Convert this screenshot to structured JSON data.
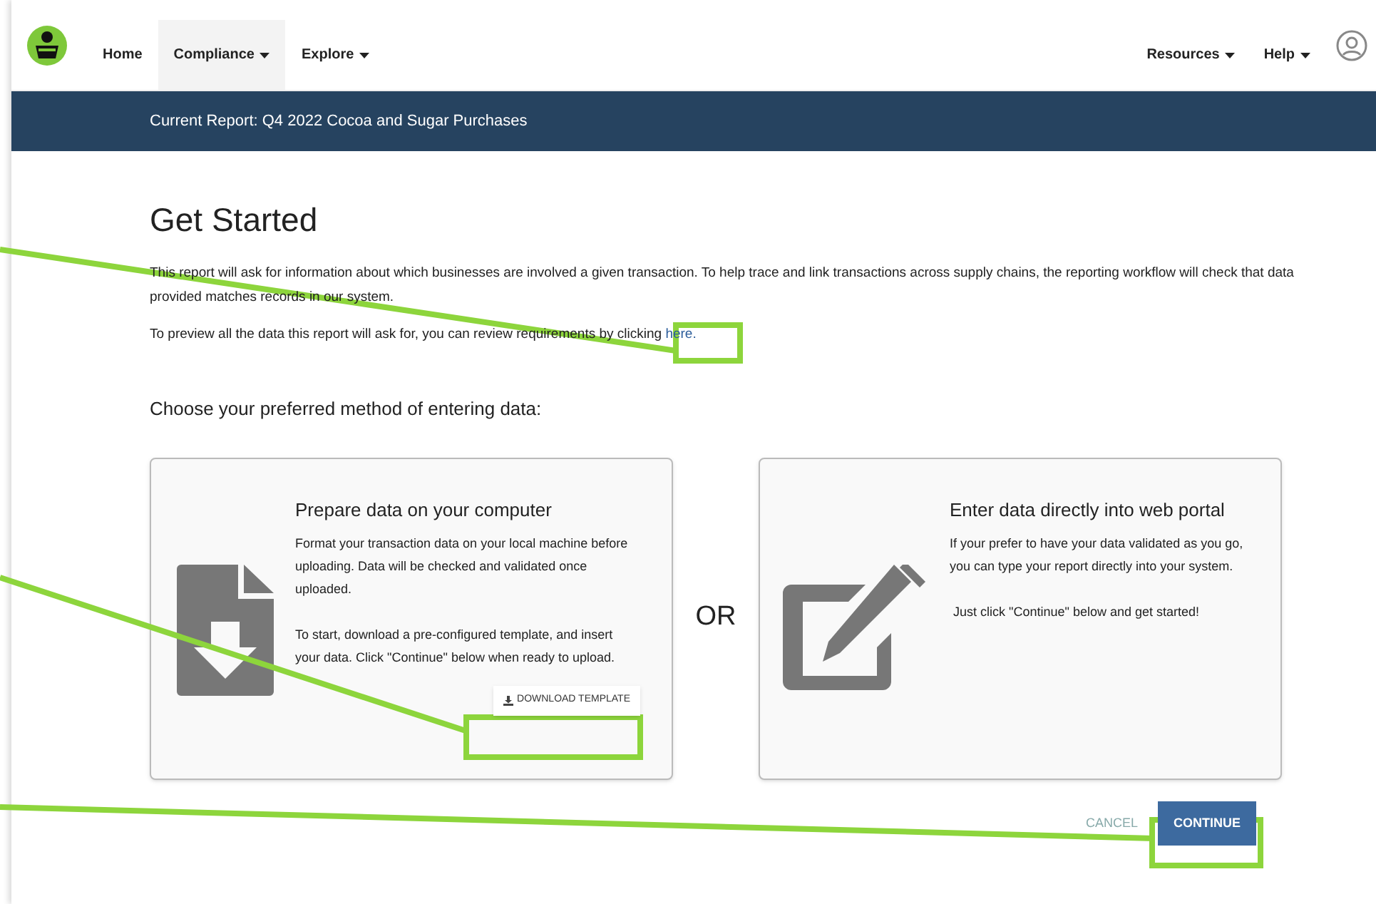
{
  "nav": {
    "items": [
      {
        "label": "Home",
        "selected": false,
        "menu": false
      },
      {
        "label": "Compliance",
        "selected": true,
        "menu": true
      },
      {
        "label": "Explore",
        "selected": false,
        "menu": true
      }
    ],
    "right_items": [
      {
        "label": "Resources",
        "menu": true
      },
      {
        "label": "Help",
        "menu": true
      }
    ]
  },
  "banner": {
    "title": "Current Report: Q4 2022 Cocoa and Sugar Purchases"
  },
  "intro": {
    "title": "Get Started",
    "paragraph": "This report will ask for information about which businesses are involved a given transaction. To help trace and link transactions across supply chains, the reporting workflow will check that data provided matches records in our system.",
    "preview_text": "To preview all the data this report will ask for, you can review requirements by clicking",
    "preview_link": "here."
  },
  "choose_title": "Choose your preferred method of entering data:",
  "options": [
    {
      "kind": "upload",
      "title": "Prepare data on your computer",
      "paragraphs": [
        "Format your transaction data on your local machine before uploading. Data will be checked and validated once uploaded.",
        "To start, download a pre-configured template, and insert your data. Click \"Continue\" below when ready to upload."
      ],
      "button": "DOWNLOAD TEMPLATE"
    },
    {
      "kind": "portal",
      "title": "Enter data directly into web portal",
      "paragraphs": [
        "If your prefer to have your data validated as you go, you can type your report directly into your system.",
        " Just click \"Continue\" below and get started!"
      ]
    }
  ],
  "separator": "OR",
  "actions": {
    "cancel": "CANCEL",
    "continue": "CONTINUE"
  }
}
